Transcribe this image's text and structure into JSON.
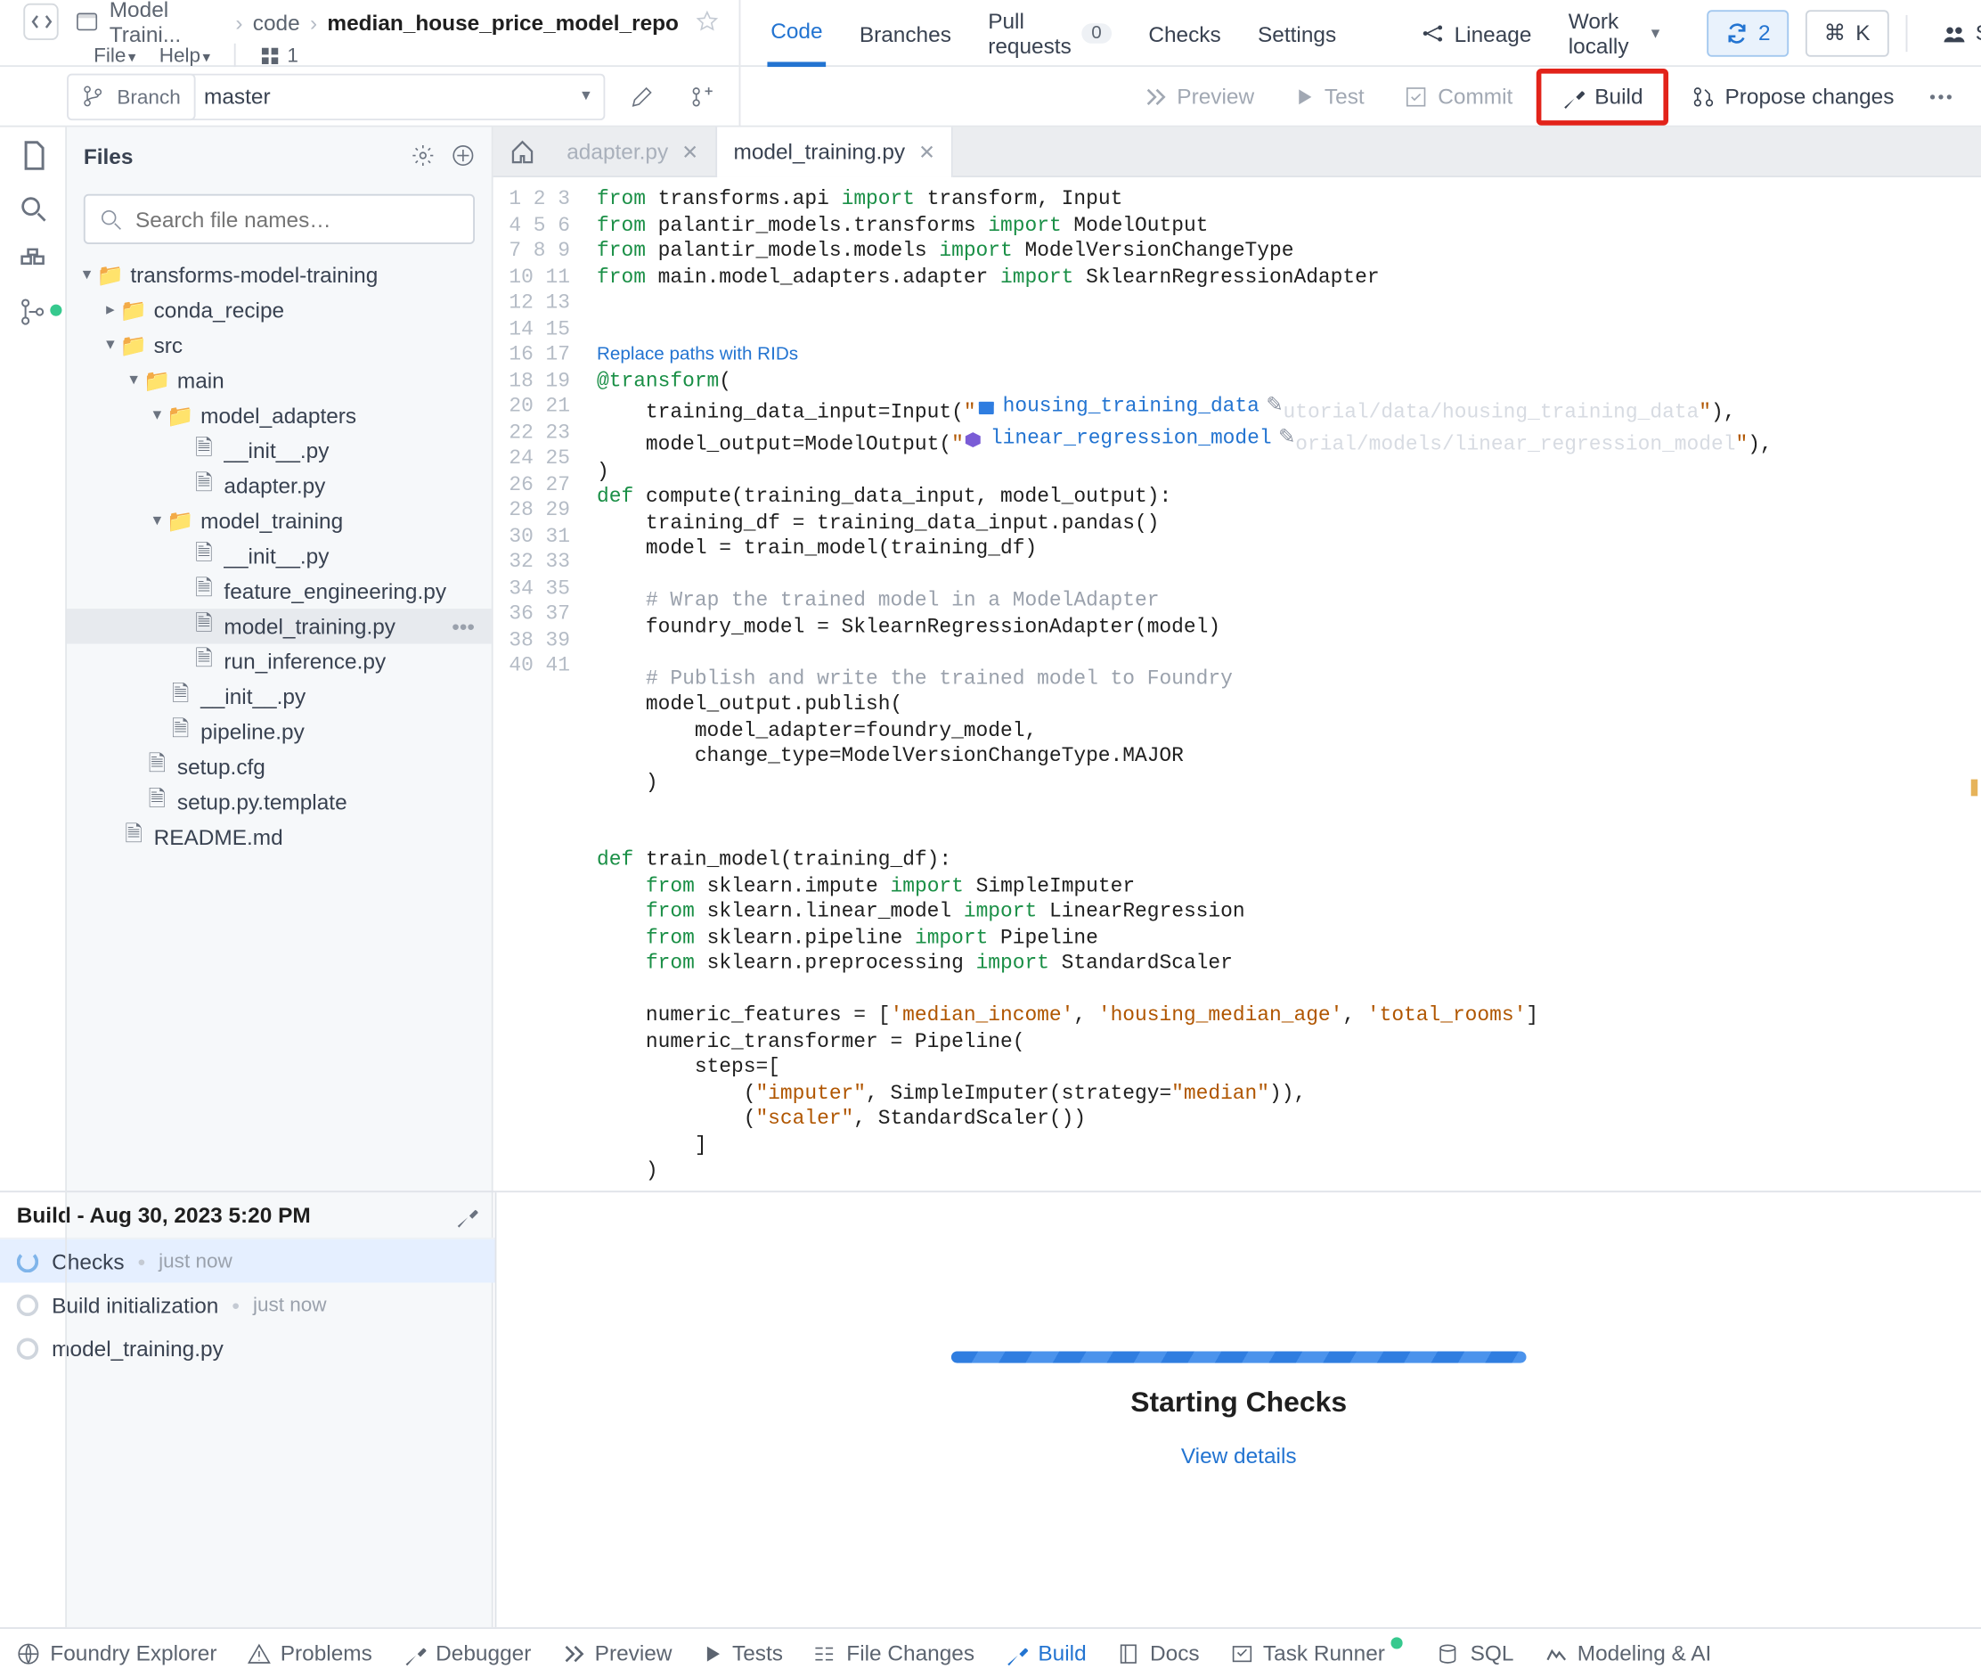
{
  "breadcrumb": {
    "project": "Model Traini...",
    "folder": "code",
    "repo": "median_house_price_model_repo"
  },
  "menus": {
    "file": "File",
    "help": "Help",
    "collab_count": "1"
  },
  "topTabs": {
    "code": "Code",
    "branches": "Branches",
    "pulls": "Pull requests",
    "pulls_count": "0",
    "checks": "Checks",
    "settings": "Settings",
    "lineage": "Lineage",
    "work": "Work locally"
  },
  "topRight": {
    "sync_count": "2",
    "cmd": "K",
    "share": "Share"
  },
  "branch": {
    "label": "Branch",
    "name": "master"
  },
  "actions": {
    "preview": "Preview",
    "test": "Test",
    "commit": "Commit",
    "build": "Build",
    "propose": "Propose changes"
  },
  "filesPanel": {
    "title": "Files",
    "search_placeholder": "Search file names…"
  },
  "tree": {
    "root": "transforms-model-training",
    "conda": "conda_recipe",
    "src": "src",
    "main": "main",
    "adapters": "model_adapters",
    "adapters_init": "__init__.py",
    "adapter_py": "adapter.py",
    "training": "model_training",
    "training_init": "__init__.py",
    "feature": "feature_engineering.py",
    "model_training_py": "model_training.py",
    "run_inf": "run_inference.py",
    "main_init": "__init__.py",
    "pipeline": "pipeline.py",
    "setup_cfg": "setup.cfg",
    "setup_tpl": "setup.py.template",
    "readme": "README.md"
  },
  "tabs": {
    "adapter": "adapter.py",
    "model_training": "model_training.py"
  },
  "hint": "Replace paths with RIDs",
  "inline": {
    "housing": "housing_training_data",
    "housing_ghost": "utorial/data/housing_training_data",
    "model": "linear_regression_model",
    "model_ghost": "orial/models/linear_regression_model"
  },
  "buildPanel": {
    "title": "Build - Aug 30, 2023 5:20 PM",
    "checks": "Checks",
    "checks_sub": "just now",
    "init": "Build initialization",
    "init_sub": "just now",
    "file": "model_training.py",
    "starting": "Starting Checks",
    "view": "View details"
  },
  "bottom": {
    "explorer": "Foundry Explorer",
    "problems": "Problems",
    "debugger": "Debugger",
    "preview": "Preview",
    "tests": "Tests",
    "changes": "File Changes",
    "build": "Build",
    "docs": "Docs",
    "runner": "Task Runner",
    "sql": "SQL",
    "ai": "Modeling & AI"
  }
}
